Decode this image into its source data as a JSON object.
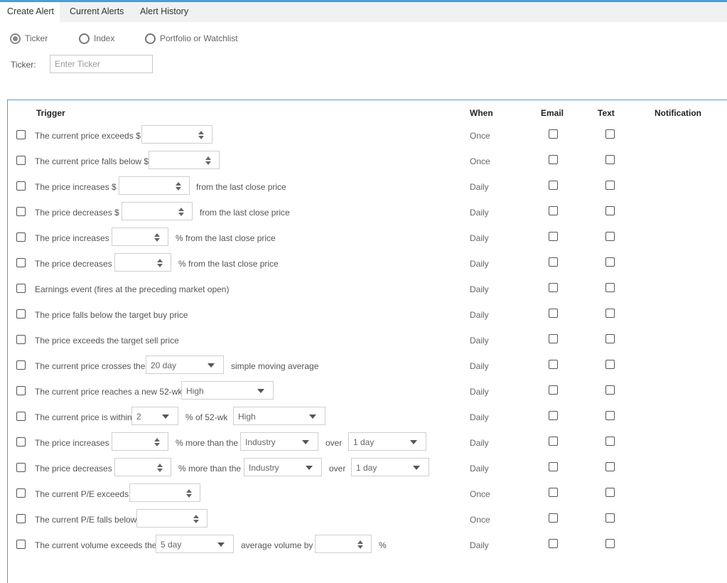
{
  "tabs": [
    {
      "label": "Create Alert",
      "active": true
    },
    {
      "label": "Current Alerts",
      "active": false
    },
    {
      "label": "Alert History",
      "active": false
    }
  ],
  "source_options": [
    {
      "label": "Ticker",
      "selected": true
    },
    {
      "label": "Index",
      "selected": false
    },
    {
      "label": "Portfolio or Watchlist",
      "selected": false
    }
  ],
  "ticker": {
    "label": "Ticker:",
    "placeholder": "Enter Ticker",
    "value": ""
  },
  "table": {
    "headers": {
      "trigger": "Trigger",
      "when": "When",
      "email": "Email",
      "text": "Text",
      "notification": "Notification"
    }
  },
  "rows": [
    {
      "prefix": "The current price exceeds $",
      "when": "Once"
    },
    {
      "prefix": "The current price falls below $",
      "when": "Once"
    },
    {
      "prefix": "The price increases $",
      "suffix": "from the last close price",
      "when": "Daily"
    },
    {
      "prefix": "The price decreases $",
      "suffix": "from the last close price",
      "when": "Daily"
    },
    {
      "prefix": "The price increases",
      "suffix": "% from the last close price",
      "when": "Daily"
    },
    {
      "prefix": "The price decreases",
      "suffix": "% from the last close price",
      "when": "Daily"
    },
    {
      "prefix": "Earnings event (fires at the preceding market open)",
      "when": "Daily"
    },
    {
      "prefix": "The price falls below the target buy price",
      "when": "Daily"
    },
    {
      "prefix": "The price exceeds the target sell price",
      "when": "Daily"
    },
    {
      "prefix": "The current price crosses the",
      "select": "20 day",
      "suffix": "simple moving average",
      "when": "Daily"
    },
    {
      "prefix": "The current price reaches a new 52-wk",
      "select": "High",
      "when": "Daily"
    },
    {
      "prefix": "The current price is within",
      "select": "2",
      "middle": "% of 52-wk",
      "select2": "High",
      "when": "Daily"
    },
    {
      "prefix": "The price increases",
      "middle": "% more than the",
      "select": "Industry",
      "middle2": "over",
      "select2": "1 day",
      "when": "Daily"
    },
    {
      "prefix": "The price decreases",
      "middle": "% more than the",
      "select": "Industry",
      "middle2": "over",
      "select2": "1 day",
      "when": "Daily"
    },
    {
      "prefix": "The current P/E exceeds",
      "when": "Once"
    },
    {
      "prefix": "The current P/E falls below",
      "when": "Once"
    },
    {
      "prefix": "The current volume exceeds the",
      "select": "5 day",
      "middle": "average volume by",
      "suffix": "%",
      "when": "Daily"
    }
  ]
}
